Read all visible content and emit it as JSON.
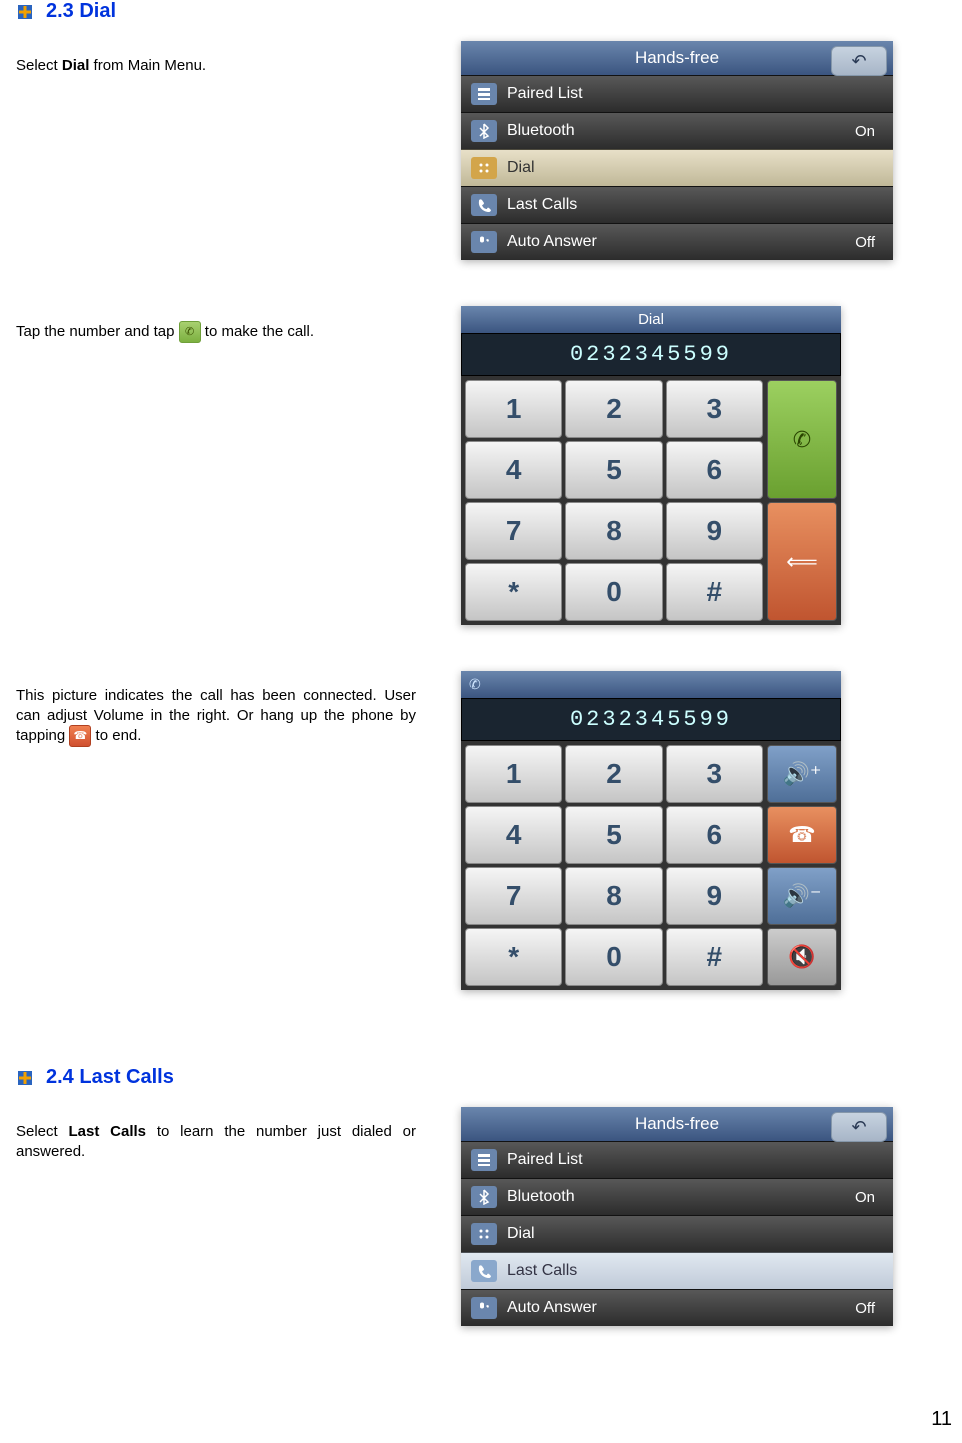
{
  "sections": {
    "s23": {
      "title": "2.3 Dial"
    },
    "s24": {
      "title": "2.4 Last Calls"
    }
  },
  "body": {
    "p1_a": "Select ",
    "p1_bold": "Dial",
    "p1_b": " from Main Menu.",
    "p2_a": "Tap the number and tap ",
    "p2_b": " to make the call.",
    "p3_a": "This picture indicates the call has been connected.  User can adjust Volume in the right.  Or hang up the phone by tapping ",
    "p3_b": " to end.",
    "p4_a": "Select ",
    "p4_bold": "Last Calls",
    "p4_b": " to learn the number just dialed or answered."
  },
  "menu1": {
    "title": "Hands-free",
    "items": [
      {
        "label": "Paired List",
        "value": ""
      },
      {
        "label": "Bluetooth",
        "value": "On"
      },
      {
        "label": "Dial",
        "value": ""
      },
      {
        "label": "Last Calls",
        "value": ""
      },
      {
        "label": "Auto Answer",
        "value": "Off"
      }
    ],
    "selected": 2
  },
  "menu2": {
    "title": "Hands-free",
    "items": [
      {
        "label": "Paired List",
        "value": ""
      },
      {
        "label": "Bluetooth",
        "value": "On"
      },
      {
        "label": "Dial",
        "value": ""
      },
      {
        "label": "Last Calls",
        "value": ""
      },
      {
        "label": "Auto Answer",
        "value": "Off"
      }
    ],
    "selected": 3
  },
  "dial": {
    "title": "Dial",
    "number": "0232345599",
    "keys": [
      "1",
      "2",
      "3",
      "4",
      "5",
      "6",
      "7",
      "8",
      "9",
      "*",
      "0",
      "#"
    ]
  },
  "connected": {
    "number": "0232345599",
    "keys": [
      "1",
      "2",
      "3",
      "4",
      "5",
      "6",
      "7",
      "8",
      "9",
      "*",
      "0",
      "#"
    ]
  },
  "page_number": "11"
}
